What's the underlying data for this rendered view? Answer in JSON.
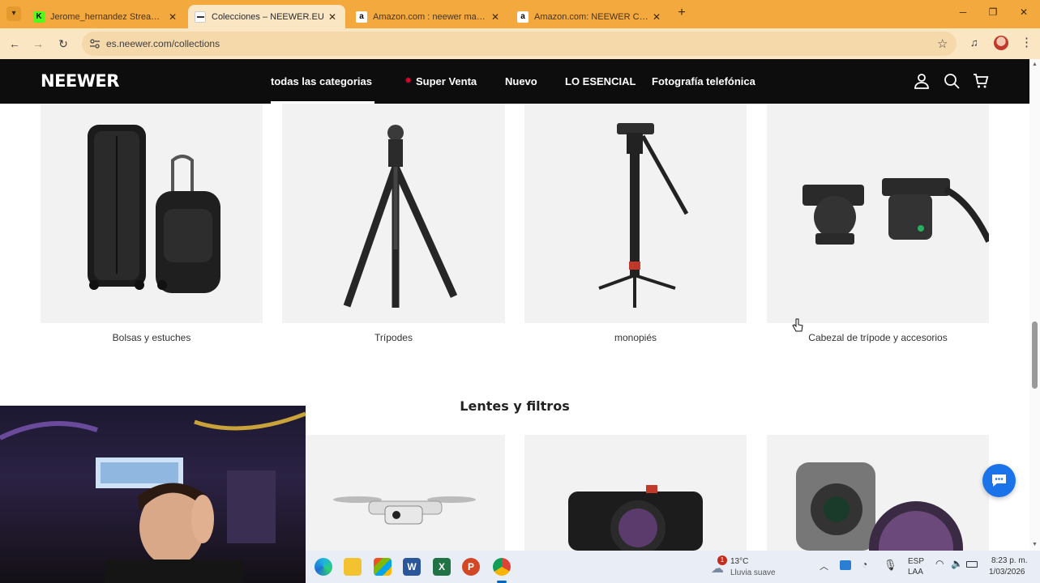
{
  "browser": {
    "tabs": [
      {
        "title": "Jerome_hernandez Stream - W",
        "favicon": "kick-icon"
      },
      {
        "title": "Colecciones – NEEWER.EU",
        "favicon": "neewer-icon"
      },
      {
        "title": "Amazon.com : neewer macro le",
        "favicon": "amazon-icon"
      },
      {
        "title": "Amazon.com: NEEWER Clip On",
        "favicon": "amazon-icon"
      }
    ],
    "new_tab": "+",
    "url": "es.neewer.com/collections"
  },
  "site": {
    "logo": "NEEWER",
    "nav": [
      {
        "label": "todas las categorias"
      },
      {
        "label": "Super Venta"
      },
      {
        "label": "Nuevo"
      },
      {
        "label": "LO ESENCIAL"
      },
      {
        "label": "Fotografía telefónica"
      }
    ],
    "accent": "#e4002b"
  },
  "collections": [
    {
      "label": "Bolsas y estuches"
    },
    {
      "label": "Trípodes"
    },
    {
      "label": "monopiés"
    },
    {
      "label": "Cabezal de trípode y accesorios"
    }
  ],
  "section": {
    "title": "Lentes y filtros"
  },
  "taskbar": {
    "weather_badge": "1",
    "temp": "13°C",
    "weather": "Lluvia suave",
    "lang1": "ESP",
    "lang2": "LAA",
    "time": "8:23 p. m.",
    "date": "1/03/2026"
  }
}
